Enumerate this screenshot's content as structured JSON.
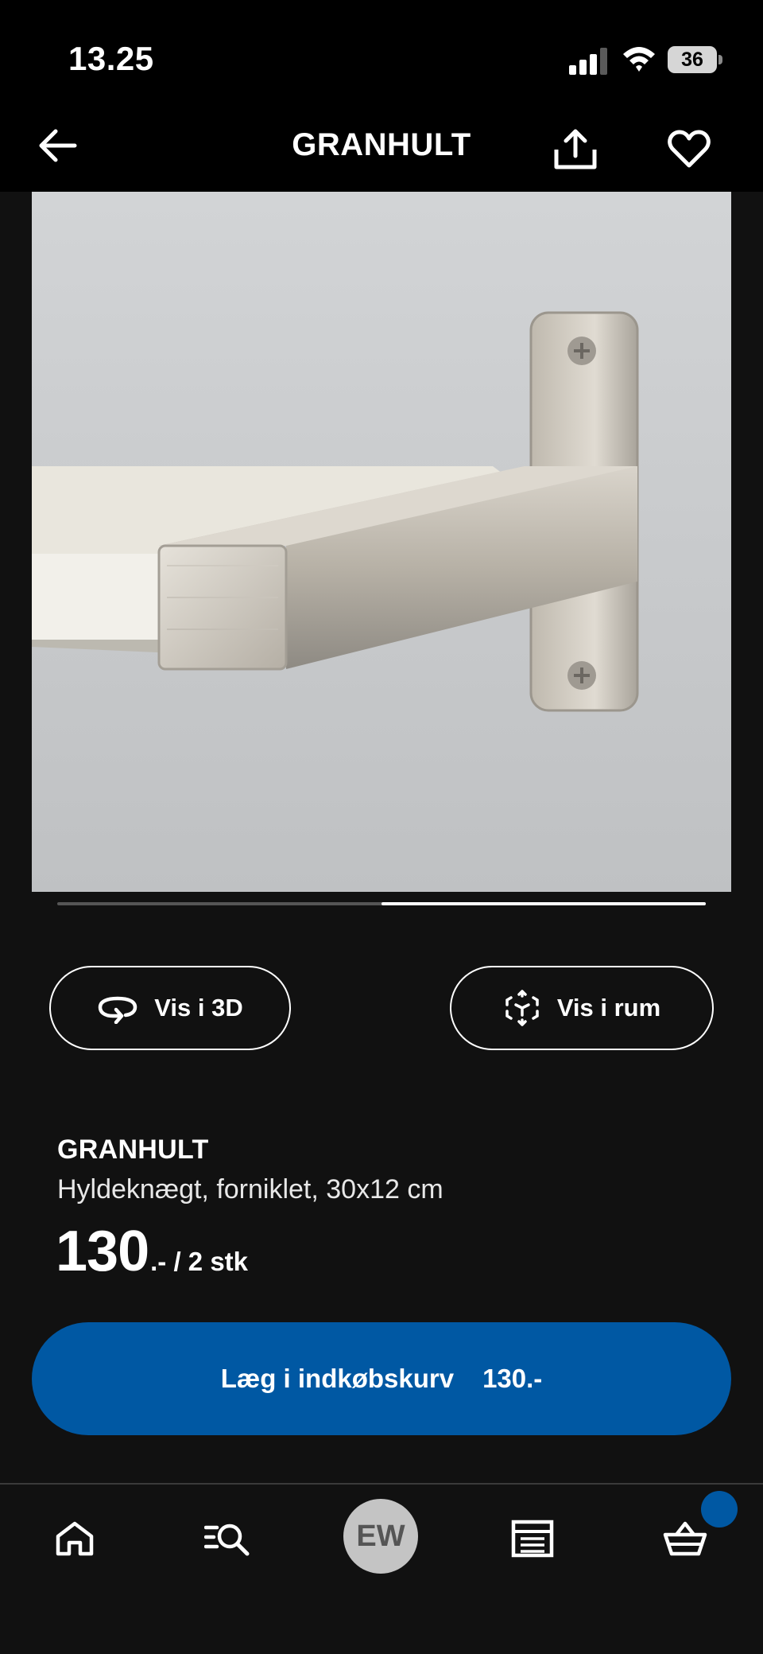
{
  "status_bar": {
    "time": "13.25",
    "battery": "36"
  },
  "header": {
    "title": "GRANHULT",
    "icons": [
      "arrow-left-icon",
      "share-icon",
      "heart-icon"
    ]
  },
  "carousel": {
    "progress": 0.5
  },
  "actions": {
    "view_3d_label": "Vis i 3D",
    "view_room_label": "Vis i rum"
  },
  "product": {
    "name": "GRANHULT",
    "description": "Hyldeknægt, forniklet, 30x12 cm",
    "price": "130",
    "price_suffix": ".- / 2 stk"
  },
  "cart_button": {
    "label": "Læg i indkøbskurv",
    "price": "130.-"
  },
  "bottom_nav": {
    "avatar_initials": "EW",
    "items": [
      "home-icon",
      "search-icon",
      "avatar",
      "store-icon",
      "cart-icon"
    ]
  },
  "colors": {
    "accent": "#0058a3",
    "background": "#111111",
    "header": "#000000"
  }
}
